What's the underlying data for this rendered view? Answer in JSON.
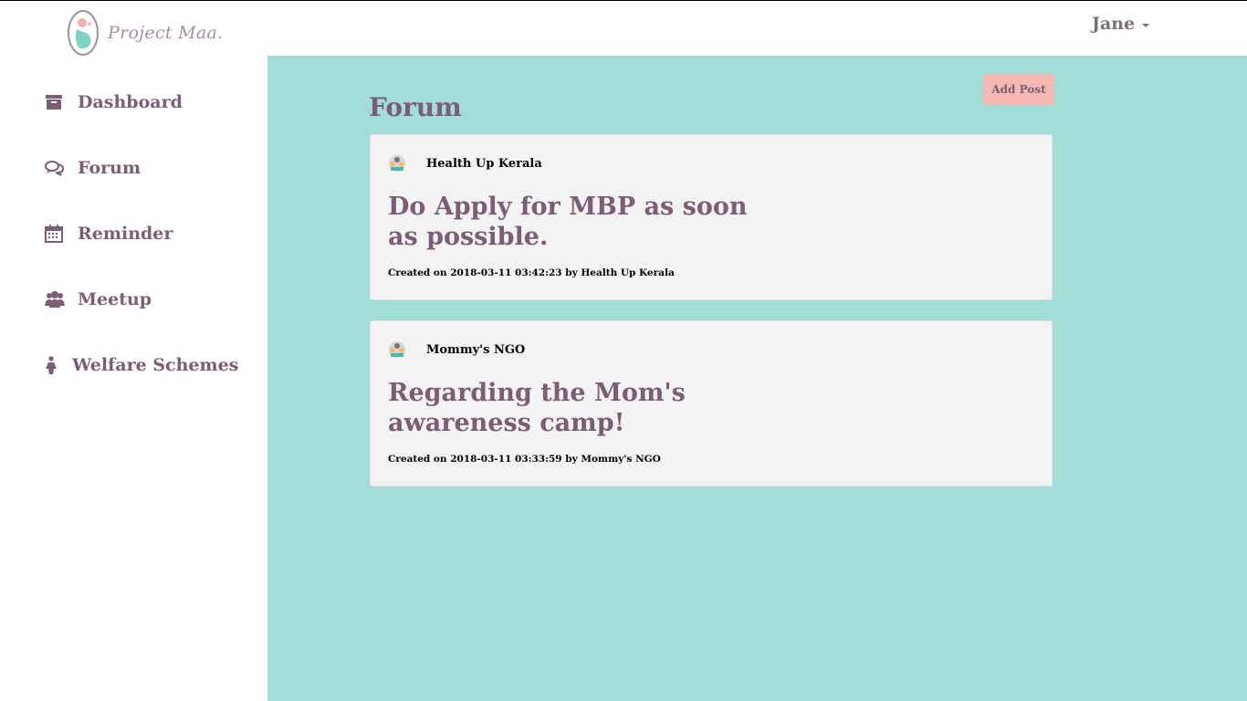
{
  "header": {
    "logo_text": "Project Maa.",
    "user_name": "Jane"
  },
  "sidebar": {
    "items": [
      {
        "label": "Dashboard",
        "icon": "archive-icon"
      },
      {
        "label": "Forum",
        "icon": "comments-icon"
      },
      {
        "label": "Reminder",
        "icon": "calendar-icon"
      },
      {
        "label": "Meetup",
        "icon": "users-icon"
      },
      {
        "label": "Welfare Schemes",
        "icon": "female-icon"
      }
    ]
  },
  "main": {
    "title": "Forum",
    "add_post_label": "Add Post",
    "posts": [
      {
        "author": "Health Up Kerala",
        "title": "Do Apply for MBP as soon as possible.",
        "meta": "Created on 2018-03-11 03:42:23 by Health Up Kerala"
      },
      {
        "author": "Mommy's NGO",
        "title": "Regarding the Mom's awareness camp!",
        "meta": "Created on 2018-03-11 03:33:59 by Mommy's NGO"
      }
    ]
  },
  "colors": {
    "accent": "#7b5e75",
    "content_bg": "#a2ddd8",
    "button_bg": "#f5b8b2",
    "card_bg": "#f3f3f3"
  }
}
